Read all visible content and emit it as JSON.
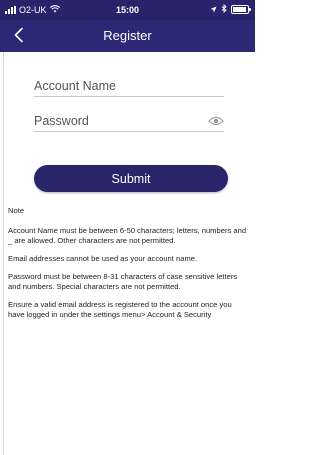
{
  "status_bar": {
    "carrier": "O2-UK",
    "time": "15:00",
    "battery_level": 0.95
  },
  "nav": {
    "title": "Register",
    "back_icon": "chevron-left-icon"
  },
  "form": {
    "account_name_placeholder": "Account Name",
    "password_placeholder": "Password",
    "password_toggle_icon": "eye-icon",
    "submit_label": "Submit"
  },
  "notes": {
    "heading": "Note",
    "items": [
      "Account Name must be between 6-50 characters; letters, numbers and _ are allowed. Other characters are not permitted.",
      "Email addresses cannot be used as your account name.",
      "Password must be between 8-31 characters of case sensitive letters and numbers. Special characters are not permitted.",
      "Ensure a valid email address is registered to the account once you have logged in under the settings menu> Account & Security"
    ]
  },
  "colors": {
    "header": "#2b2876",
    "button": "#28256b",
    "text": "#1f1f1f"
  }
}
